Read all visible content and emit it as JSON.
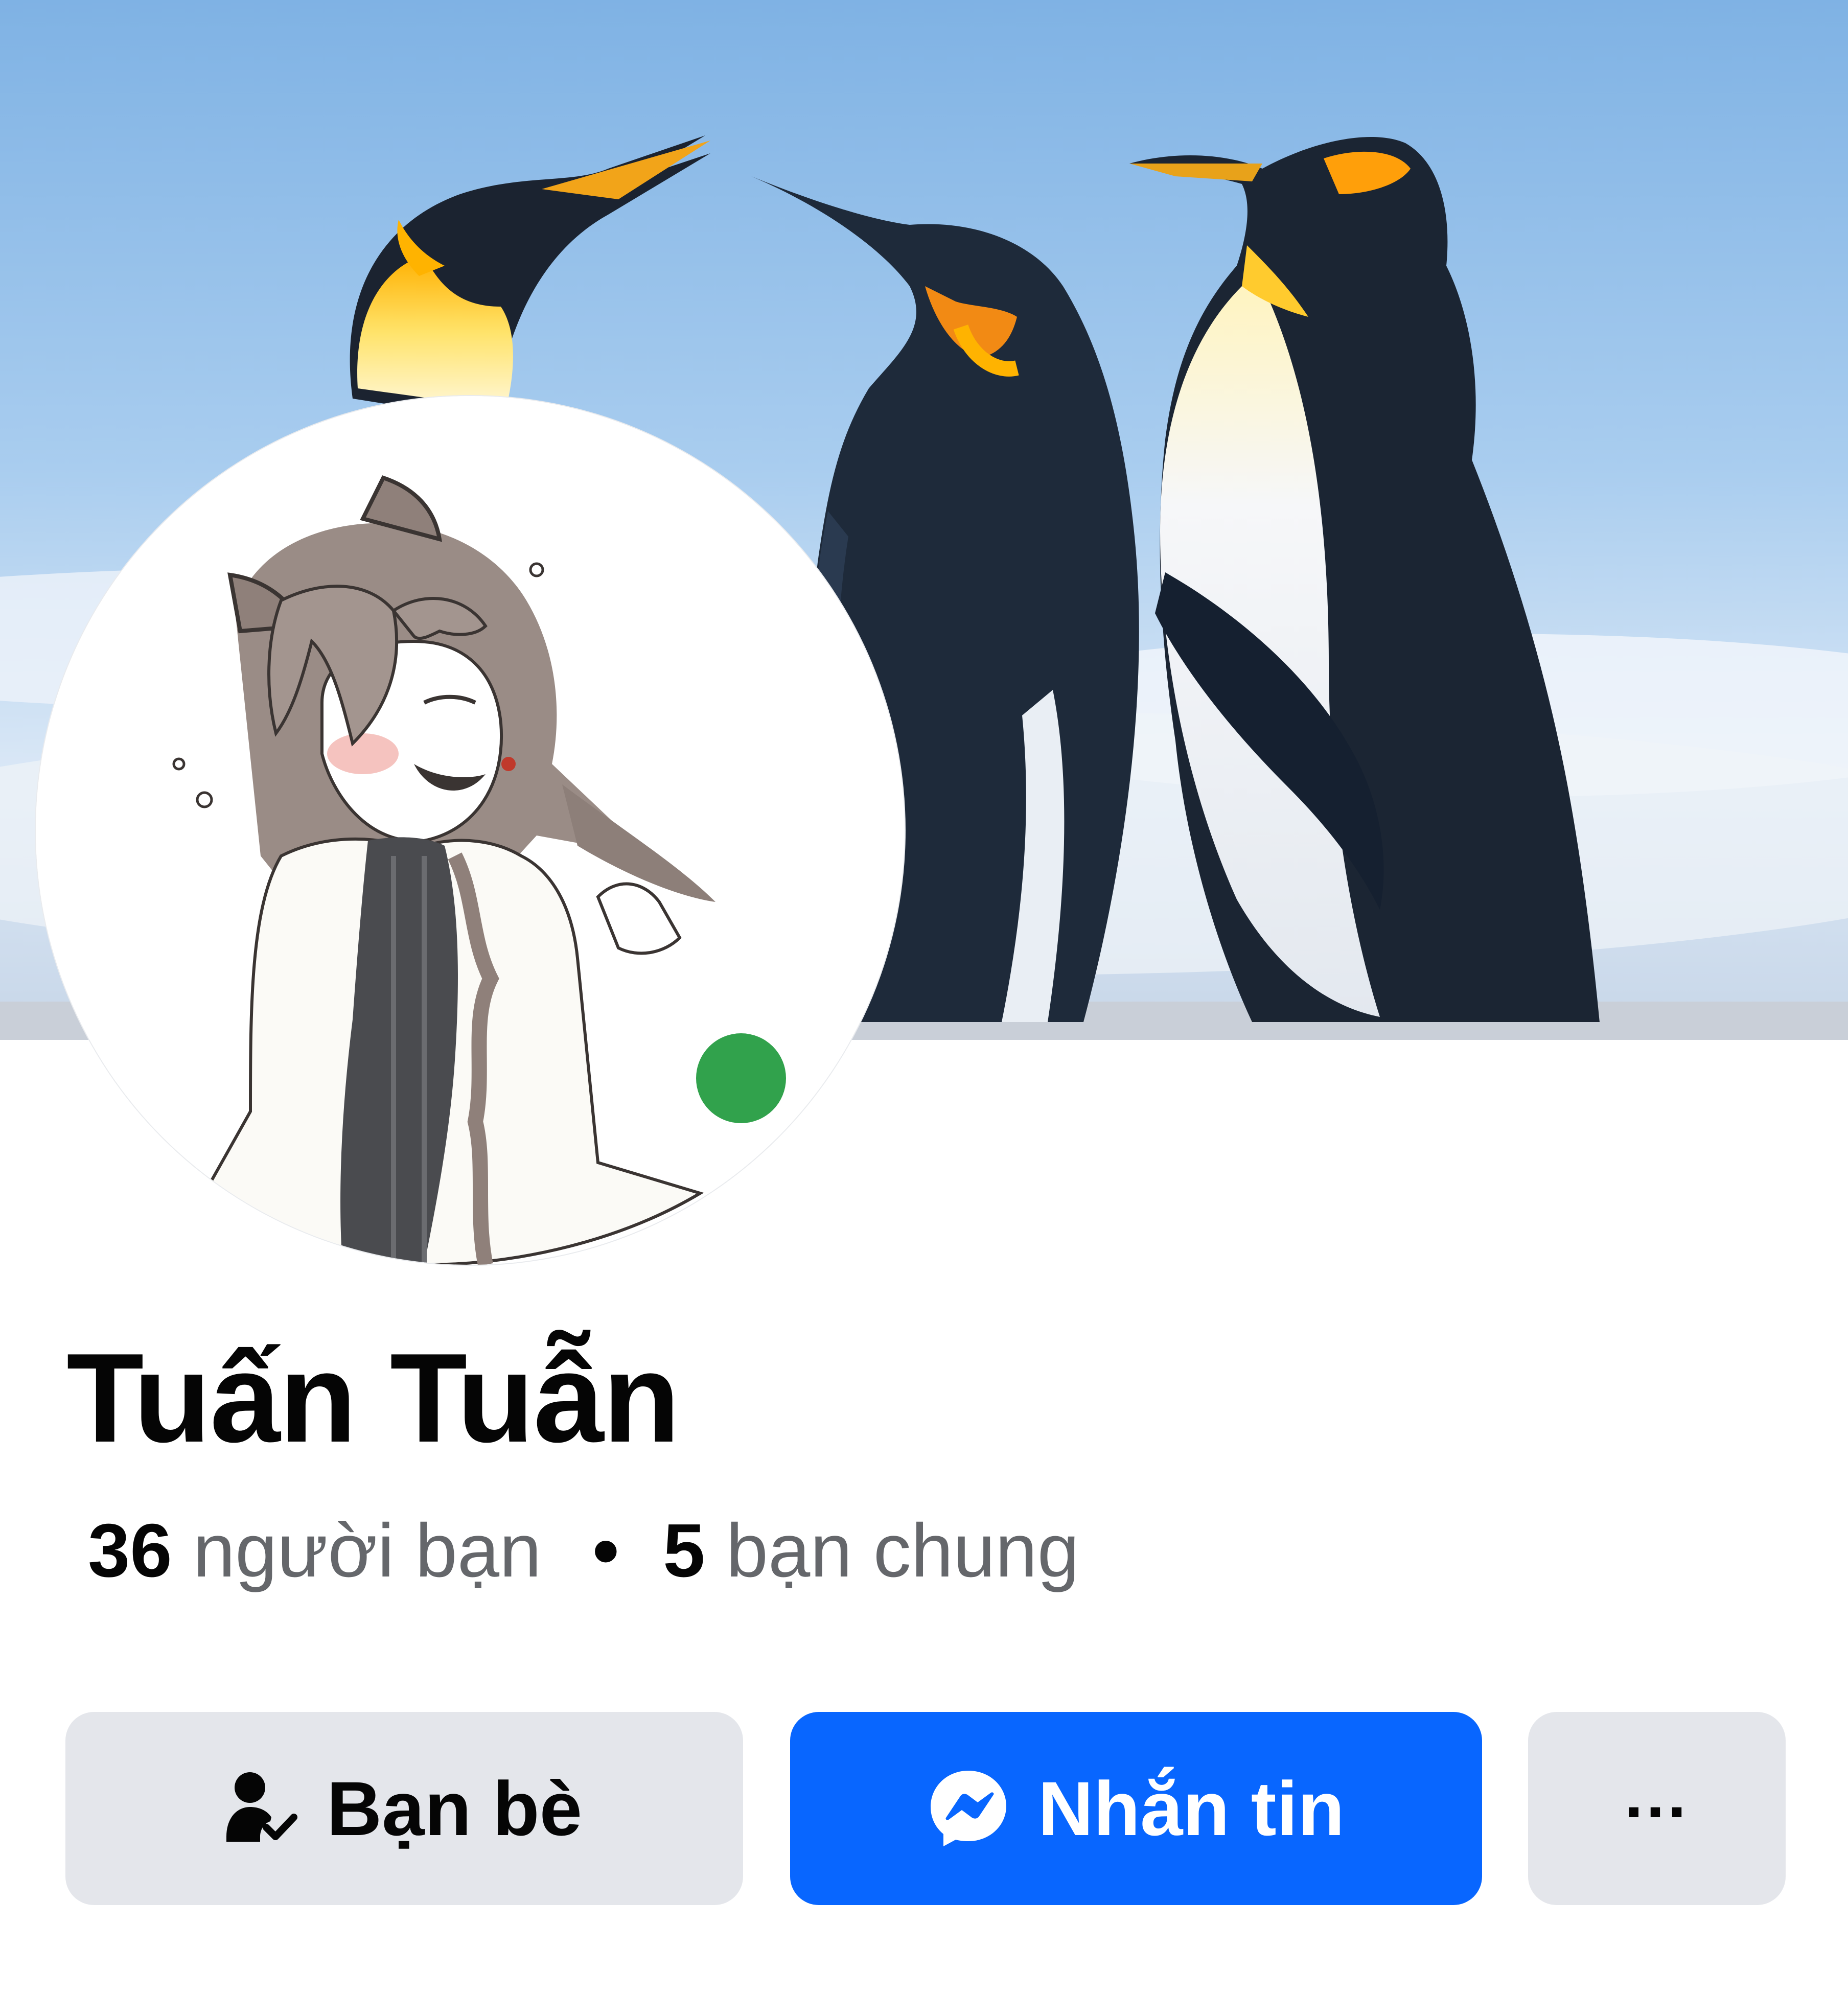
{
  "profile": {
    "name": "Tuấn Tuẫn",
    "friends_count": "36",
    "friends_label": "người bạn",
    "separator": "•",
    "mutual_count": "5",
    "mutual_label": "bạn chung",
    "online": true
  },
  "actions": {
    "friends_button": {
      "label": "Bạn bè",
      "icon": "person-check-icon"
    },
    "message_button": {
      "label": "Nhắn tin",
      "icon": "messenger-icon"
    },
    "more_button": {
      "label": "...",
      "icon": "more-dots-icon"
    }
  },
  "colors": {
    "primary_blue": "#0866ff",
    "secondary_button": "#e4e6eb",
    "online_green": "#31a24c",
    "text_primary": "#050505",
    "text_secondary": "#65676b"
  },
  "images": {
    "cover": "cover-photo-penguins",
    "avatar": "avatar-anime-character"
  }
}
